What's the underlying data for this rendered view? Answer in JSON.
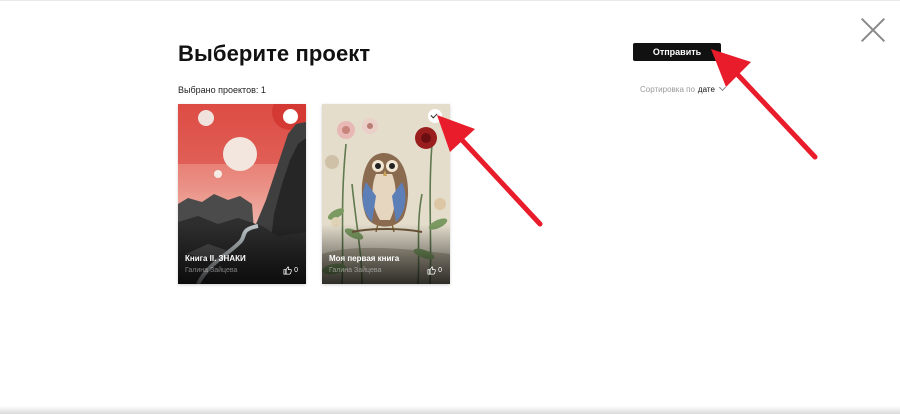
{
  "modal": {
    "title": "Выберите проект",
    "send_label": "Отправить",
    "selected_count": "Выбрано проектов: 1",
    "sort_label": "Сортировка по",
    "sort_value": "дате"
  },
  "projects": [
    {
      "name": "Книга II. ЗНАКИ",
      "author": "Галина Зайцева",
      "likes": "0",
      "selected": false
    },
    {
      "name": "Моя первая книга",
      "author": "Галина Зайцева",
      "likes": "0",
      "selected": true
    }
  ],
  "colors": {
    "accent_arrow": "#e81c2a",
    "button_bg": "#111111"
  },
  "icons": [
    "close-icon",
    "chevron-down-icon",
    "like-icon",
    "check-icon"
  ]
}
